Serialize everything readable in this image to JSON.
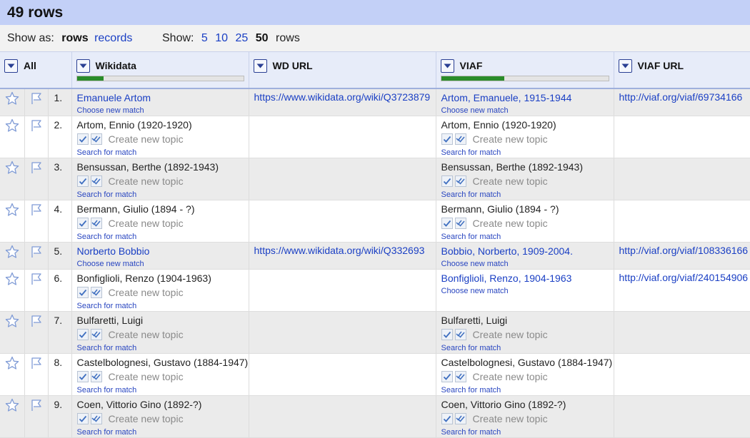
{
  "header": {
    "title": "49 rows"
  },
  "view": {
    "show_as_label": "Show as:",
    "rows_label": "rows",
    "records_label": "records",
    "show_label": "Show:",
    "counts": [
      "5",
      "10",
      "25",
      "50"
    ],
    "selected_count": "50",
    "rows_suffix": "rows"
  },
  "columns": {
    "all": "All",
    "wikidata": "Wikidata",
    "wd_url": "WD URL",
    "viaf": "VIAF",
    "viaf_url": "VIAF URL"
  },
  "progress": {
    "wikidata": 0.16,
    "viaf": 0.38,
    "fill_color": "#2a8c2a"
  },
  "labels": {
    "choose_new_match": "Choose new match",
    "search_for_match": "Search for match",
    "create_new_topic": "Create new topic"
  },
  "rows": [
    {
      "num": "1.",
      "wikidata": "Emanuele Artom",
      "wikidata_matched": true,
      "wd_url": "https://www.wikidata.org/wiki/Q3723879",
      "viaf": "Artom, Emanuele, 1915-1944",
      "viaf_matched": true,
      "viaf_url": "http://viaf.org/viaf/69734166"
    },
    {
      "num": "2.",
      "wikidata": "Artom, Ennio (1920-1920)",
      "wikidata_matched": false,
      "wd_url": "",
      "viaf": "Artom, Ennio (1920-1920)",
      "viaf_matched": false,
      "viaf_url": ""
    },
    {
      "num": "3.",
      "wikidata": "Bensussan, Berthe (1892-1943)",
      "wikidata_matched": false,
      "wd_url": "",
      "viaf": "Bensussan, Berthe (1892-1943)",
      "viaf_matched": false,
      "viaf_url": ""
    },
    {
      "num": "4.",
      "wikidata": "Bermann, Giulio (1894 - ?)",
      "wikidata_matched": false,
      "wd_url": "",
      "viaf": "Bermann, Giulio (1894 - ?)",
      "viaf_matched": false,
      "viaf_url": ""
    },
    {
      "num": "5.",
      "wikidata": "Norberto Bobbio",
      "wikidata_matched": true,
      "wd_url": "https://www.wikidata.org/wiki/Q332693",
      "viaf": "Bobbio, Norberto, 1909-2004.",
      "viaf_matched": true,
      "viaf_url": "http://viaf.org/viaf/108336166"
    },
    {
      "num": "6.",
      "wikidata": "Bonfiglioli, Renzo (1904-1963)",
      "wikidata_matched": false,
      "wd_url": "",
      "viaf": "Bonfiglioli, Renzo, 1904-1963",
      "viaf_matched": true,
      "viaf_url": "http://viaf.org/viaf/240154906"
    },
    {
      "num": "7.",
      "wikidata": "Bulfaretti, Luigi",
      "wikidata_matched": false,
      "wd_url": "",
      "viaf": "Bulfaretti, Luigi",
      "viaf_matched": false,
      "viaf_url": ""
    },
    {
      "num": "8.",
      "wikidata": "Castelbolognesi, Gustavo (1884-1947)",
      "wikidata_matched": false,
      "wd_url": "",
      "viaf": "Castelbolognesi, Gustavo (1884-1947)",
      "viaf_matched": false,
      "viaf_url": ""
    },
    {
      "num": "9.",
      "wikidata": "Coen, Vittorio Gino (1892-?)",
      "wikidata_matched": false,
      "wd_url": "",
      "viaf": "Coen, Vittorio Gino (1892-?)",
      "viaf_matched": false,
      "viaf_url": ""
    }
  ],
  "icons": {
    "star": "star-icon",
    "flag": "flag-icon",
    "dropdown": "dropdown-arrow-icon",
    "check": "check-icon",
    "double_check": "double-check-icon"
  }
}
